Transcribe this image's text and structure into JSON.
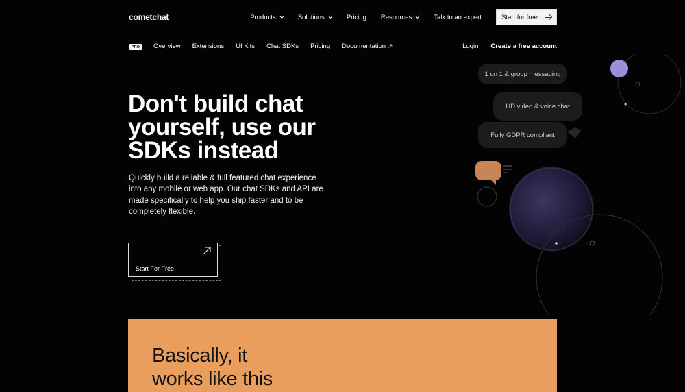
{
  "topnav": {
    "logo": "cometchat",
    "links": [
      {
        "label": "Products",
        "dropdown": true
      },
      {
        "label": "Solutions",
        "dropdown": true
      },
      {
        "label": "Pricing",
        "dropdown": false
      },
      {
        "label": "Resources",
        "dropdown": true
      },
      {
        "label": "Talk to an expert",
        "dropdown": false
      }
    ],
    "cta": "Start for free"
  },
  "subnav": {
    "badge": "PRO",
    "links": [
      "Overview",
      "Extensions",
      "UI Kits",
      "Chat SDKs",
      "Pricing",
      "Documentation"
    ],
    "external_arrow": "↗",
    "login": "Login",
    "create_account": "Create a free account"
  },
  "hero": {
    "title": "Don't build chat yourself, use our SDKs instead",
    "description": "Quickly build a reliable & full featured chat experience into any mobile or web app. Our chat SDKs and API are made specifically to help you ship faster and to be completely flexible.",
    "cta": "Start For Free"
  },
  "bubbles": [
    "1 on 1 & group messaging",
    "HD video & voice chat",
    "Fully GDPR compliant"
  ],
  "section": {
    "title_line1": "Basically, it",
    "title_line2": "works like this"
  },
  "colors": {
    "background": "#030303",
    "accent_orange": "#e99e5e",
    "bubble": "#1c1c1c",
    "purple": "#9a8fd8"
  }
}
